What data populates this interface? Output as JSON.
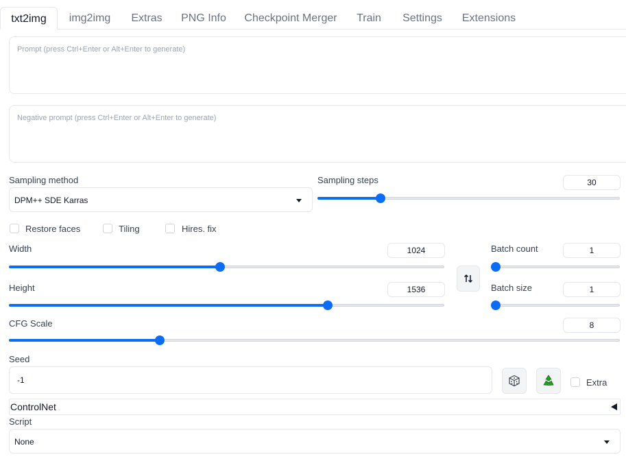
{
  "tabs": [
    "txt2img",
    "img2img",
    "Extras",
    "PNG Info",
    "Checkpoint Merger",
    "Train",
    "Settings",
    "Extensions"
  ],
  "prompt": {
    "placeholder": "Prompt (press Ctrl+Enter or Alt+Enter to generate)"
  },
  "negative_prompt": {
    "placeholder": "Negative prompt (press Ctrl+Enter or Alt+Enter to generate)"
  },
  "sampling_method": {
    "label": "Sampling method",
    "value": "DPM++ SDE Karras"
  },
  "sampling_steps": {
    "label": "Sampling steps",
    "value": "30",
    "fraction": 0.2
  },
  "checkboxes": {
    "restore_faces": "Restore faces",
    "tiling": "Tiling",
    "hires_fix": "Hires. fix"
  },
  "width": {
    "label": "Width",
    "value": "1024",
    "fraction": 0.484
  },
  "height": {
    "label": "Height",
    "value": "1536",
    "fraction": 0.737
  },
  "batch_count": {
    "label": "Batch count",
    "value": "1",
    "fraction": 0.0
  },
  "batch_size": {
    "label": "Batch size",
    "value": "1",
    "fraction": 0.0
  },
  "cfg_scale": {
    "label": "CFG Scale",
    "value": "8",
    "fraction": 0.243
  },
  "seed": {
    "label": "Seed",
    "value": "-1",
    "extra_label": "Extra"
  },
  "controlnet": {
    "label": "ControlNet"
  },
  "script": {
    "label": "Script",
    "value": "None"
  },
  "colors": {
    "accent": "#0b6df6",
    "recycle": "#22a022"
  },
  "icons": {
    "swap": "swap-arrows-icon",
    "dice": "dice-icon",
    "recycle": "recycle-icon",
    "collapse": "triangle-left-icon"
  }
}
